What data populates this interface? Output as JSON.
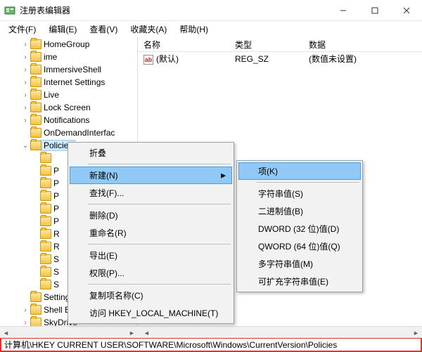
{
  "titlebar": {
    "title": "注册表编辑器"
  },
  "menubar": {
    "file": "文件(F)",
    "edit": "编辑(E)",
    "view": "查看(V)",
    "favorites": "收藏夹(A)",
    "help": "帮助(H)"
  },
  "list": {
    "headers": {
      "name": "名称",
      "type": "类型",
      "data": "数据"
    },
    "rows": [
      {
        "name": "(默认)",
        "type": "REG_SZ",
        "data": "(数值未设置)"
      }
    ]
  },
  "tree": {
    "items": [
      {
        "label": "HomeGroup",
        "depth": 1,
        "expander": ">"
      },
      {
        "label": "ime",
        "depth": 1,
        "expander": ">"
      },
      {
        "label": "ImmersiveShell",
        "depth": 1,
        "expander": ">"
      },
      {
        "label": "Internet Settings",
        "depth": 1,
        "expander": ">"
      },
      {
        "label": "Live",
        "depth": 1,
        "expander": ">"
      },
      {
        "label": "Lock Screen",
        "depth": 1,
        "expander": ">"
      },
      {
        "label": "Notifications",
        "depth": 1,
        "expander": ">"
      },
      {
        "label": "OnDemandInterfac",
        "depth": 1,
        "expander": ""
      },
      {
        "label": "Policies",
        "depth": 1,
        "expander": "v",
        "selected": true
      },
      {
        "label": "",
        "depth": 2,
        "expander": ""
      },
      {
        "label": "P",
        "depth": 2,
        "expander": ""
      },
      {
        "label": "P",
        "depth": 2,
        "expander": ""
      },
      {
        "label": "P",
        "depth": 2,
        "expander": ""
      },
      {
        "label": "P",
        "depth": 2,
        "expander": ""
      },
      {
        "label": "P",
        "depth": 2,
        "expander": ""
      },
      {
        "label": "R",
        "depth": 2,
        "expander": ""
      },
      {
        "label": "R",
        "depth": 2,
        "expander": ""
      },
      {
        "label": "S",
        "depth": 2,
        "expander": ""
      },
      {
        "label": "S",
        "depth": 2,
        "expander": ""
      },
      {
        "label": "S",
        "depth": 2,
        "expander": ""
      },
      {
        "label": "SettingSync",
        "depth": 1,
        "expander": ""
      },
      {
        "label": "Shell Extensions",
        "depth": 1,
        "expander": ">"
      },
      {
        "label": "SkyDrive",
        "depth": 1,
        "expander": ">"
      }
    ]
  },
  "context1": {
    "collapse": "折叠",
    "new": "新建(N)",
    "find": "查找(F)...",
    "delete": "删除(D)",
    "rename": "重命名(R)",
    "export": "导出(E)",
    "permissions": "权限(P)...",
    "copykey": "复制项名称(C)",
    "goto": "访问 HKEY_LOCAL_MACHINE(T)"
  },
  "context2": {
    "key": "项(K)",
    "string": "字符串值(S)",
    "binary": "二进制值(B)",
    "dword": "DWORD (32 位)值(D)",
    "qword": "QWORD (64 位)值(Q)",
    "multi": "多字符串值(M)",
    "expand": "可扩充字符串值(E)"
  },
  "statusbar": {
    "path": "计算机\\HKEY CURRENT USER\\SOFTWARE\\Microsoft\\Windows\\CurrentVersion\\Policies"
  }
}
